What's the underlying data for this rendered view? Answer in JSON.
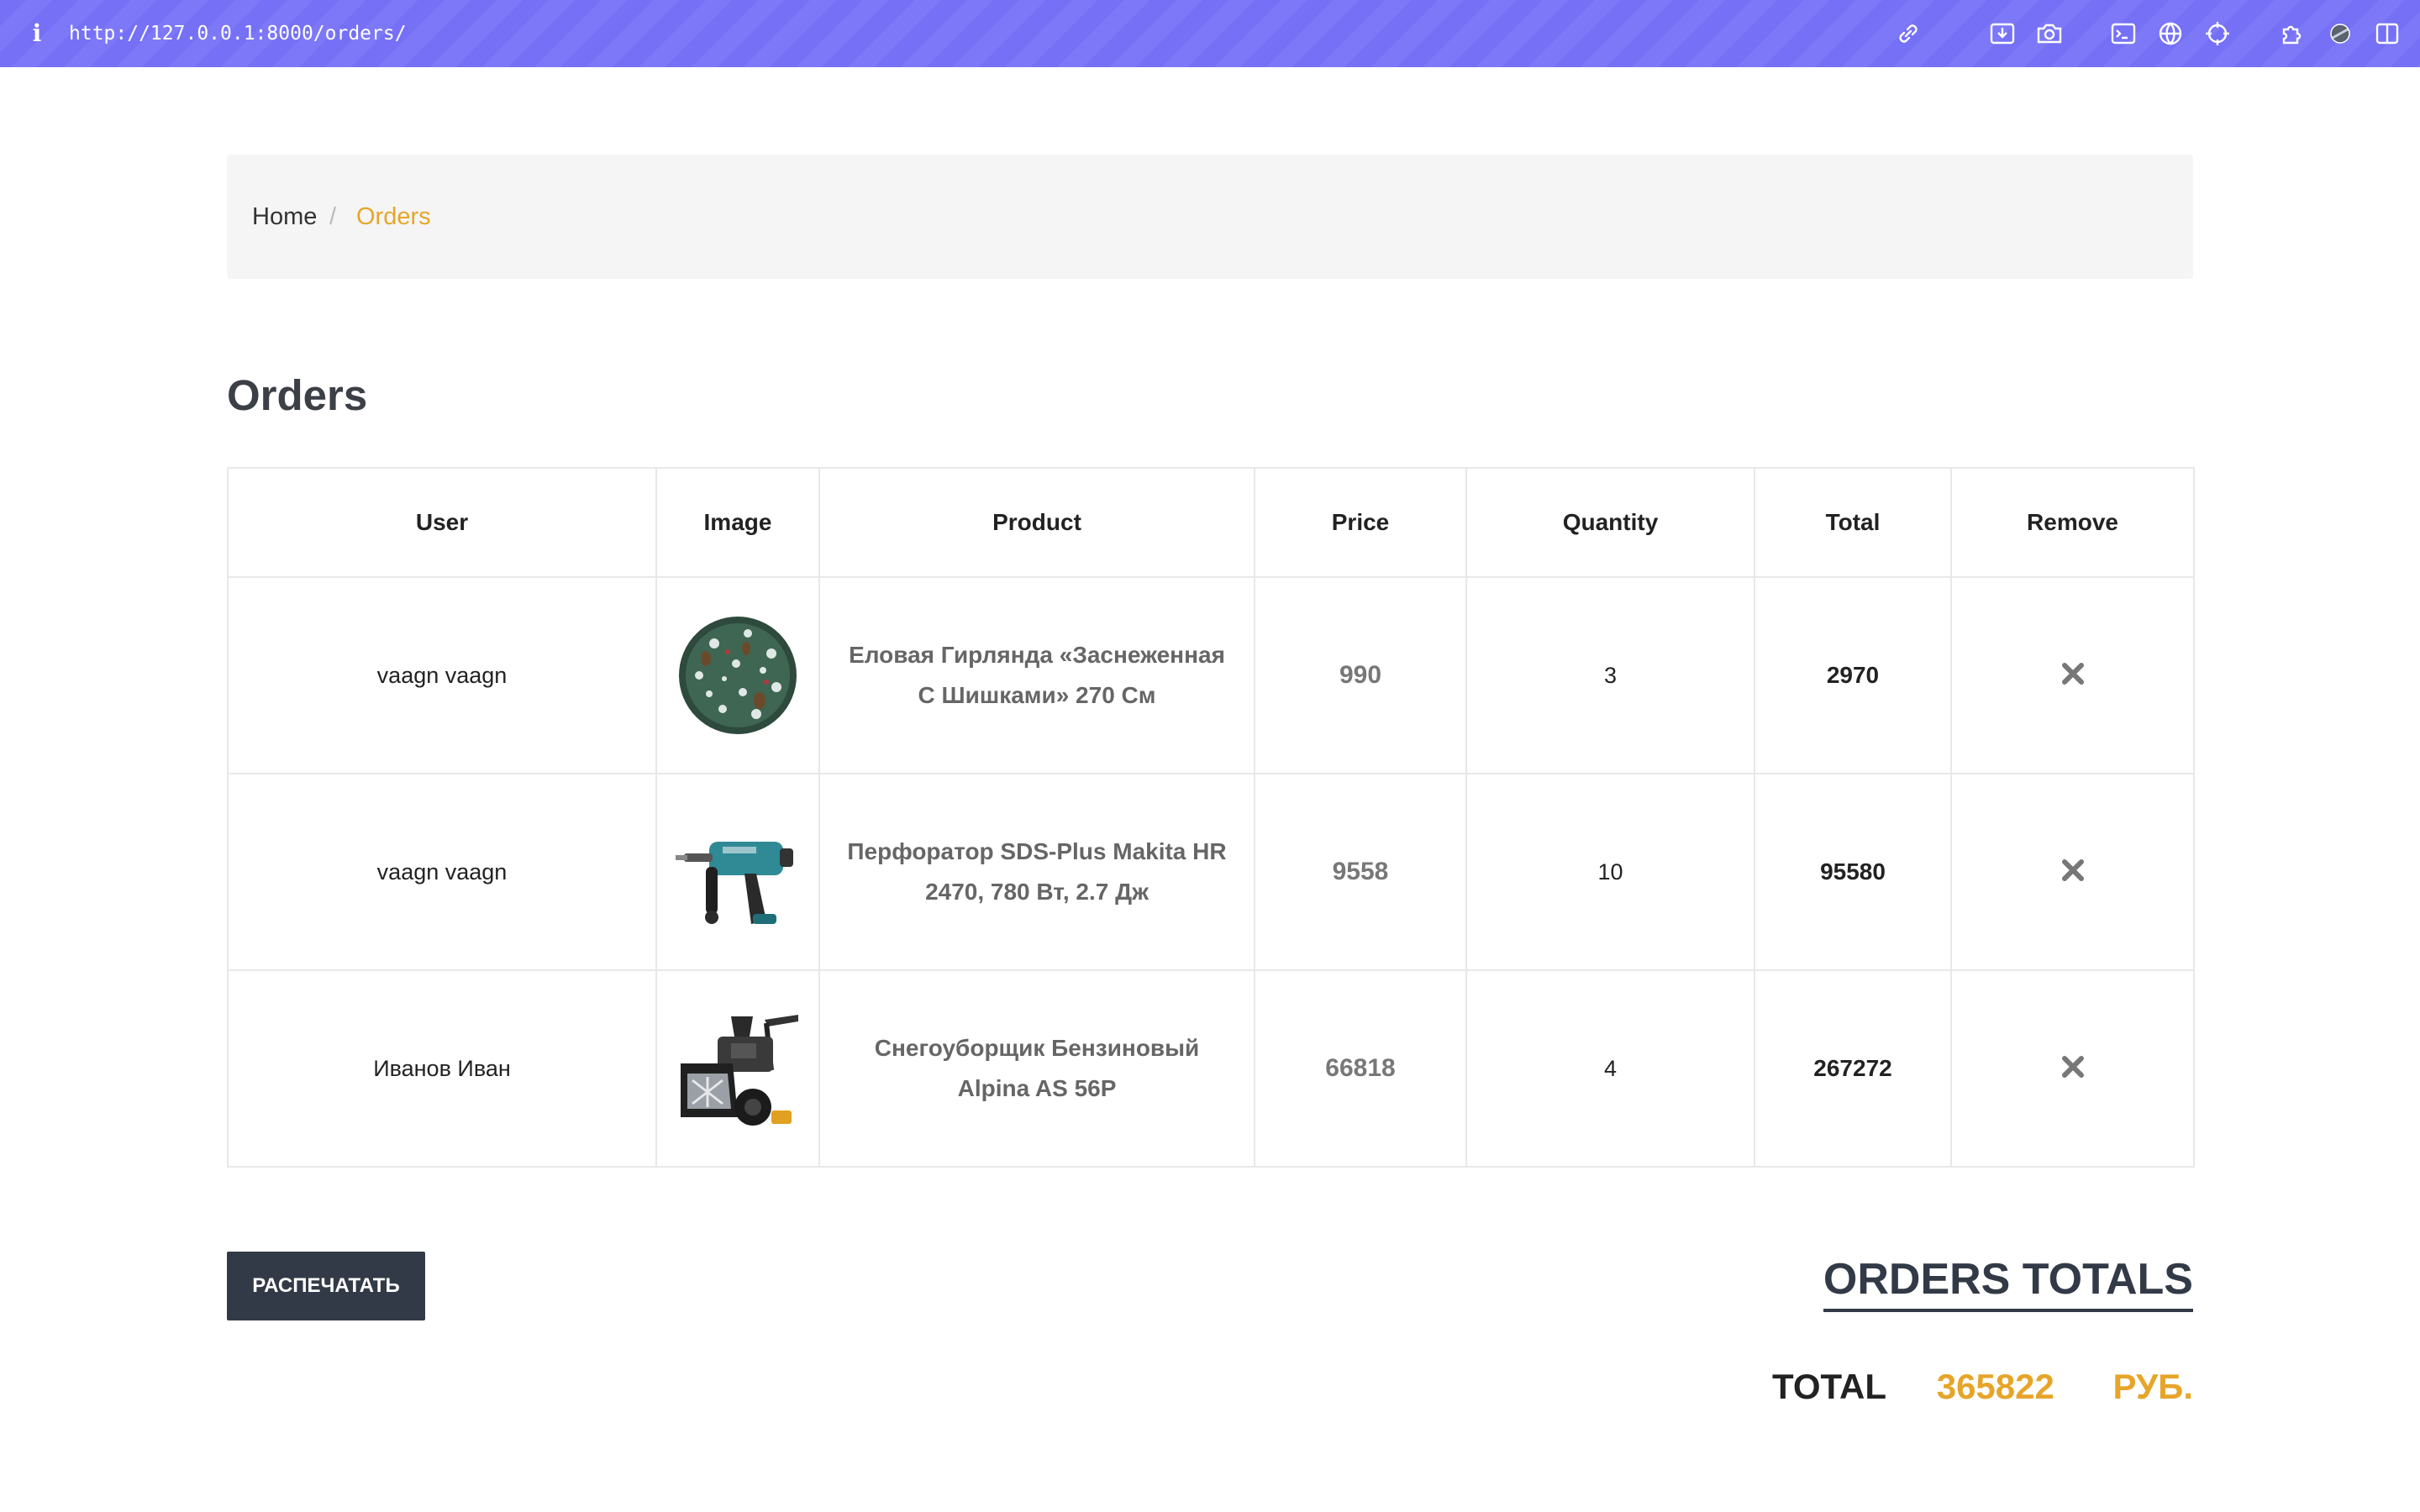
{
  "browser": {
    "url": "http://127.0.0.1:8000/orders/",
    "info_icon": "i",
    "icons": [
      "link-icon",
      "download-icon",
      "camera-icon",
      "terminal-icon",
      "globe-icon",
      "crosshair-icon",
      "extensions-icon",
      "profile-icon",
      "sidebar-icon"
    ]
  },
  "breadcrumb": {
    "home": "Home",
    "separator": "/",
    "current": "Orders"
  },
  "page": {
    "title": "Orders"
  },
  "table": {
    "headers": [
      "User",
      "Image",
      "Product",
      "Price",
      "Quantity",
      "Total",
      "Remove"
    ],
    "rows": [
      {
        "user": "vaagn vaagn",
        "image": "garland-image",
        "product": "Еловая Гирлянда «Заснеженная С Шишками» 270 См",
        "price": "990",
        "quantity": "3",
        "total": "2970",
        "remove_icon": "close-icon"
      },
      {
        "user": "vaagn vaagn",
        "image": "hammer-drill-image",
        "product": "Перфоратор SDS-Plus Makita HR 2470, 780 Вт, 2.7 Дж",
        "price": "9558",
        "quantity": "10",
        "total": "95580",
        "remove_icon": "close-icon"
      },
      {
        "user": "Иванов Иван",
        "image": "snowblower-image",
        "product": "Снегоуборщик Бензиновый Alpina AS 56P",
        "price": "66818",
        "quantity": "4",
        "total": "267272",
        "remove_icon": "close-icon"
      }
    ]
  },
  "actions": {
    "print_label": "РАСПЕЧАТАТЬ"
  },
  "totals": {
    "heading": "ORDERS TOTALS",
    "label": "TOTAL",
    "value": "365822",
    "currency": "РУБ."
  },
  "colors": {
    "accent": "#e6a52a",
    "dark": "#333a47",
    "topbar": "#7570f5"
  }
}
